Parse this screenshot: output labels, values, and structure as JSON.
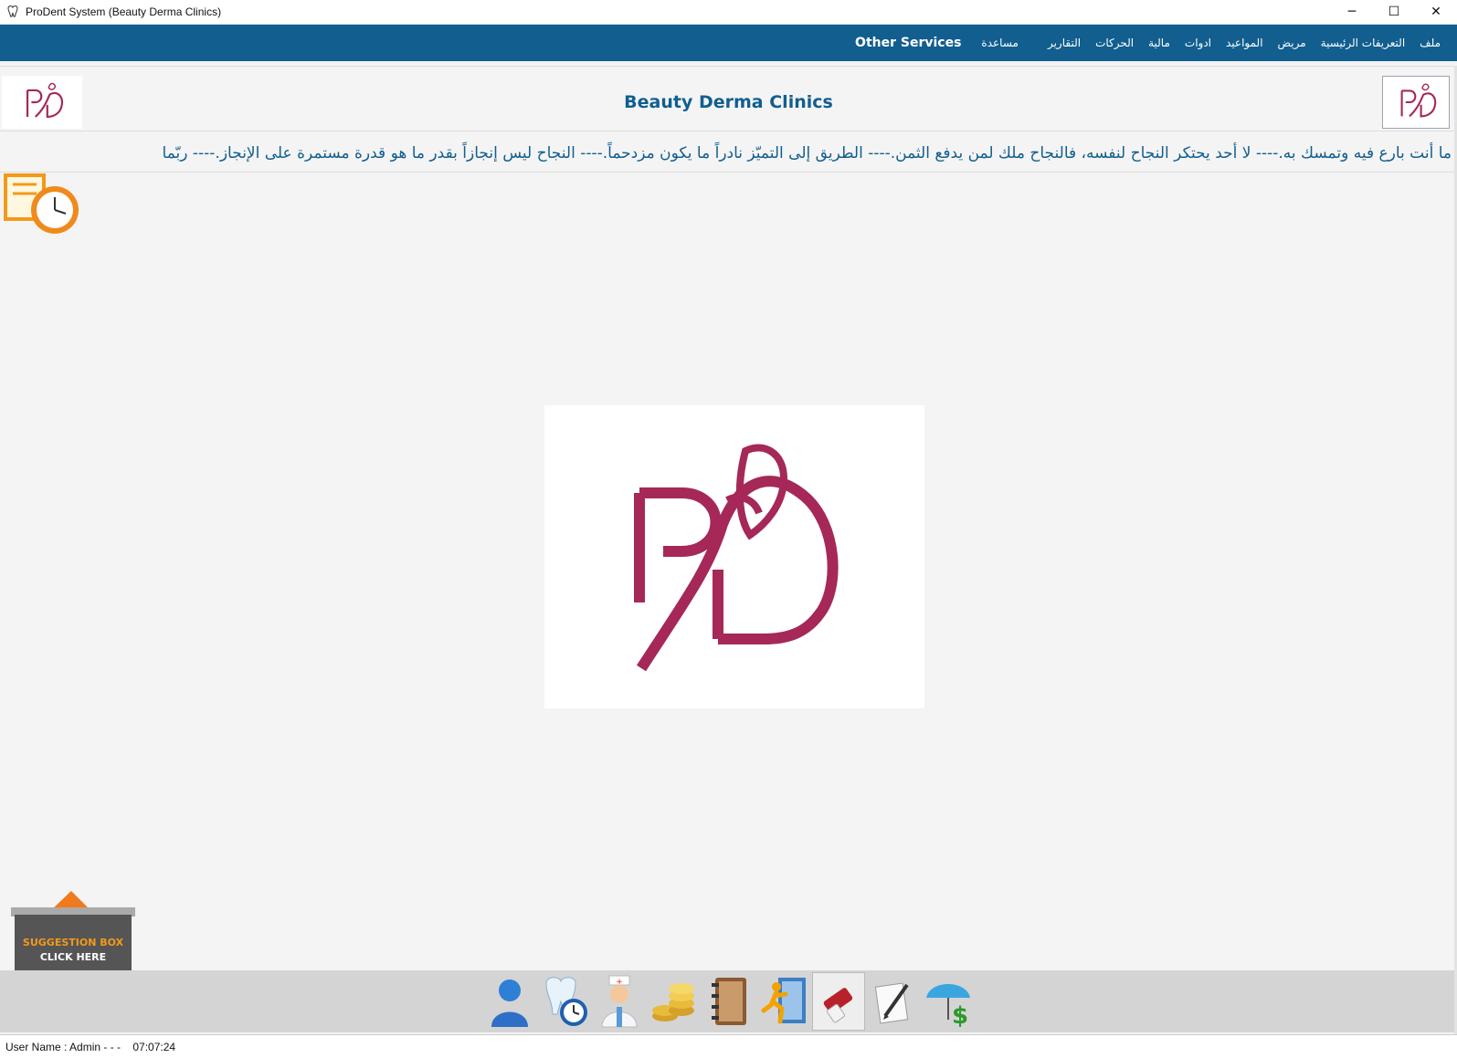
{
  "window": {
    "title": "ProDent System (Beauty Derma Clinics)",
    "controls": {
      "minimize": "─",
      "maximize": "☐",
      "close": "✕"
    }
  },
  "menu": {
    "items": [
      {
        "label": "ملف",
        "icon": ""
      },
      {
        "label": "التعريفات الرئيسية"
      },
      {
        "label": "مريض"
      },
      {
        "label": "المواعيد"
      },
      {
        "label": "ادوات"
      },
      {
        "label": "مالية"
      },
      {
        "label": "الحركات"
      },
      {
        "label": "التقارير"
      },
      {
        "label": "مساعدة"
      },
      {
        "label": "Other Services"
      }
    ]
  },
  "header": {
    "clinic_name": "Beauty Derma Clinics",
    "logo_color": "#a52858"
  },
  "ticker": {
    "text": "ما أنت بارع فيه وتمسك به.---- لا أحد يحتكر النجاح لنفسه، فالنجاح ملك لمن يدفع الثمن.---- الطريق إلى التميّز نادراً ما يكون مزدحماً.---- النجاح ليس إنجازاً بقدر ما هو قدرة مستمرة على الإنجاز.---- ربّما"
  },
  "suggestion_box": {
    "line1": "SUGGESTION BOX",
    "line2": "CLICK HERE"
  },
  "taskbar": {
    "icons": [
      "user-icon",
      "tooth-clock-icon",
      "nurse-icon",
      "coins-icon",
      "address-book-icon",
      "runner-exit-icon",
      "eraser-icon",
      "pen-paper-icon",
      "umbrella-dollar-icon"
    ]
  },
  "status": {
    "text": "User Name : Admin - - -    07:07:24"
  },
  "colors": {
    "menubar": "#115e8f",
    "brand": "#a52858",
    "background": "#f4f4f4"
  }
}
